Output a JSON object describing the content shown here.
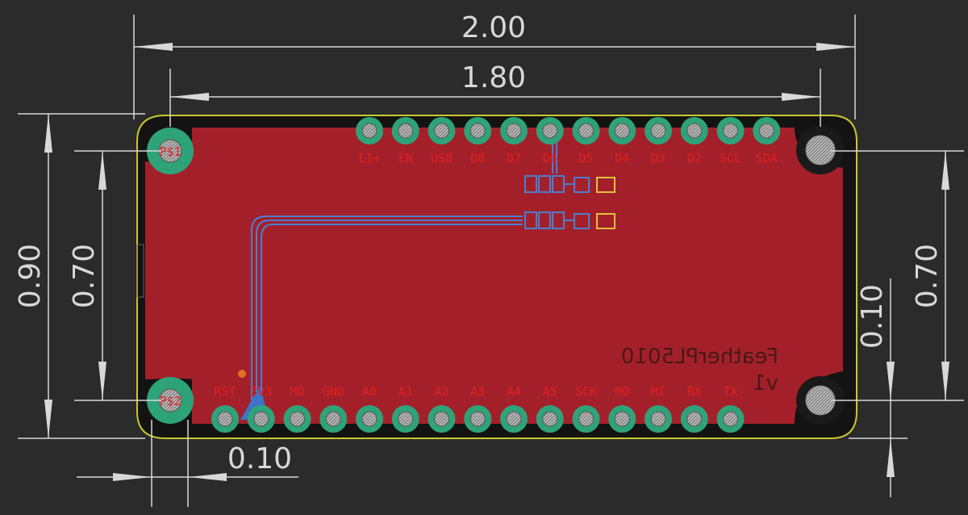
{
  "colors": {
    "background": "#2b2b2b",
    "board_fill": "#a3202a",
    "board_outline": "#c8c830",
    "dimension_lines": "#d8d8d8",
    "pad_green": "#2ea37a",
    "pin_label": "#e02020",
    "trace_blue": "#4a7fd0"
  },
  "dimensions": {
    "overall_width": "2.00",
    "hole_spacing_width": "1.80",
    "overall_height": "0.90",
    "hole_spacing_height_left": "0.70",
    "hole_spacing_height_right": "0.70",
    "hole_offset_right": "0.10",
    "hole_offset_bottom": "0.10"
  },
  "mounting_holes": [
    "P$1",
    "P$2",
    "",
    ""
  ],
  "top_header": {
    "pins": [
      "LI+",
      "EN",
      "USB",
      "D8",
      "D7",
      "D6",
      "D5",
      "D4",
      "D3",
      "D2",
      "SCL",
      "SDA"
    ]
  },
  "bottom_header": {
    "pins": [
      "RST",
      "3V3",
      "MD",
      "GND",
      "A0",
      "A1",
      "A2",
      "A3",
      "A4",
      "A5",
      "SCK",
      "MO",
      "MI",
      "RX",
      "TX"
    ]
  },
  "silkscreen": {
    "board_name": "FeatherPL5010",
    "version": "v1"
  }
}
